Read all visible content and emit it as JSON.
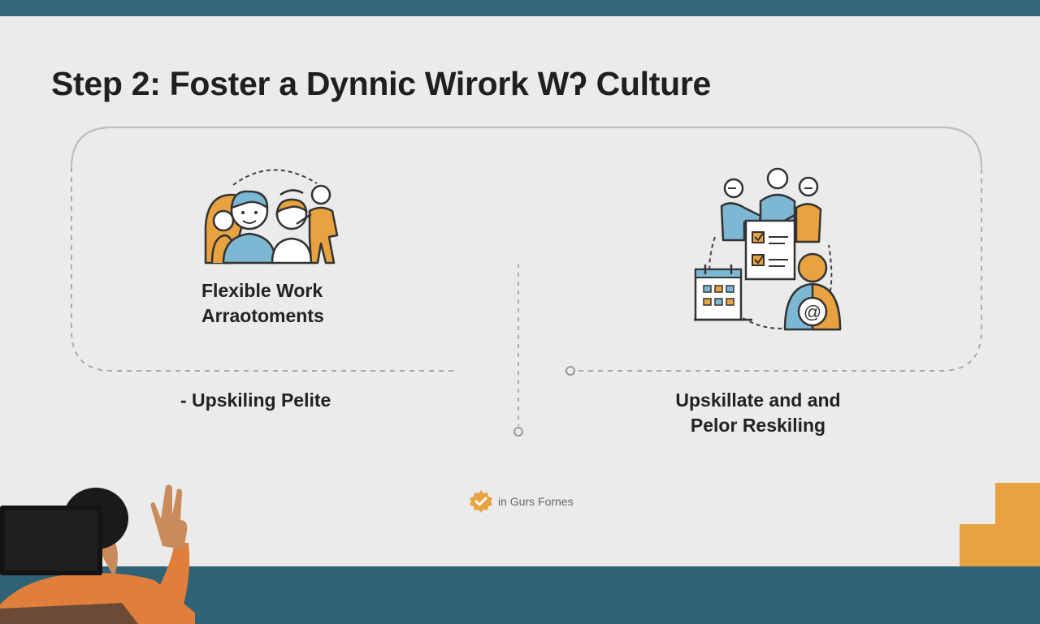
{
  "slide": {
    "title": "Step 2: Foster a Dynnic Wirork Wʔ Culture",
    "left_panel": {
      "icon": "team-people-icon",
      "label_line1": "Flexible Work",
      "label_line2": "Arraotoments",
      "sub_label": "- Upskiling Pelite"
    },
    "right_panel": {
      "icon": "team-checklist-calendar-icon",
      "label_line1": "Upskillate and and",
      "label_line2": "Pelor Reskiling"
    },
    "footer_brand": {
      "icon": "check-badge-icon",
      "text": "in Gurs Fornes"
    }
  },
  "colors": {
    "accent_orange": "#e8a23f",
    "accent_blue": "#7cb8d3",
    "slide_background": "#ebebeb",
    "band_teal": "#2f6274",
    "presenter_shirt": "#e07e3c"
  }
}
